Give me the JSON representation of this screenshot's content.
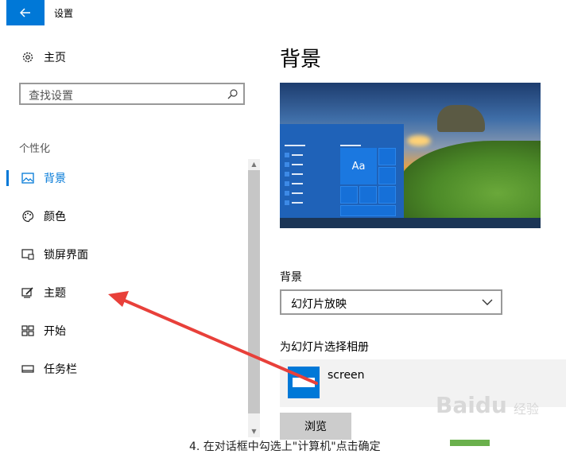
{
  "window": {
    "title": "设置"
  },
  "nav": {
    "home_label": "主页",
    "search_placeholder": "查找设置",
    "section_label": "个性化",
    "items": [
      {
        "label": "背景",
        "icon": "image-icon",
        "active": true
      },
      {
        "label": "颜色",
        "icon": "palette-icon",
        "active": false
      },
      {
        "label": "锁屏界面",
        "icon": "lock-screen-icon",
        "active": false
      },
      {
        "label": "主题",
        "icon": "theme-icon",
        "active": false
      },
      {
        "label": "开始",
        "icon": "start-icon",
        "active": false
      },
      {
        "label": "任务栏",
        "icon": "taskbar-icon",
        "active": false
      }
    ]
  },
  "main": {
    "title": "背景",
    "preview": {
      "tile_text": "Aa"
    },
    "background_label": "背景",
    "background_select": {
      "value": "幻灯片放映"
    },
    "album_label": "为幻灯片选择相册",
    "album_item": {
      "name": "screen"
    },
    "browse_label": "浏览"
  },
  "overlay": {
    "caption": "4. 在对话框中勾选上\"计算机\"点击确定",
    "watermark_brand": "Baidu",
    "watermark_sub": "经验",
    "arrow_color": "#e8403a"
  },
  "colors": {
    "accent": "#0078d7"
  }
}
